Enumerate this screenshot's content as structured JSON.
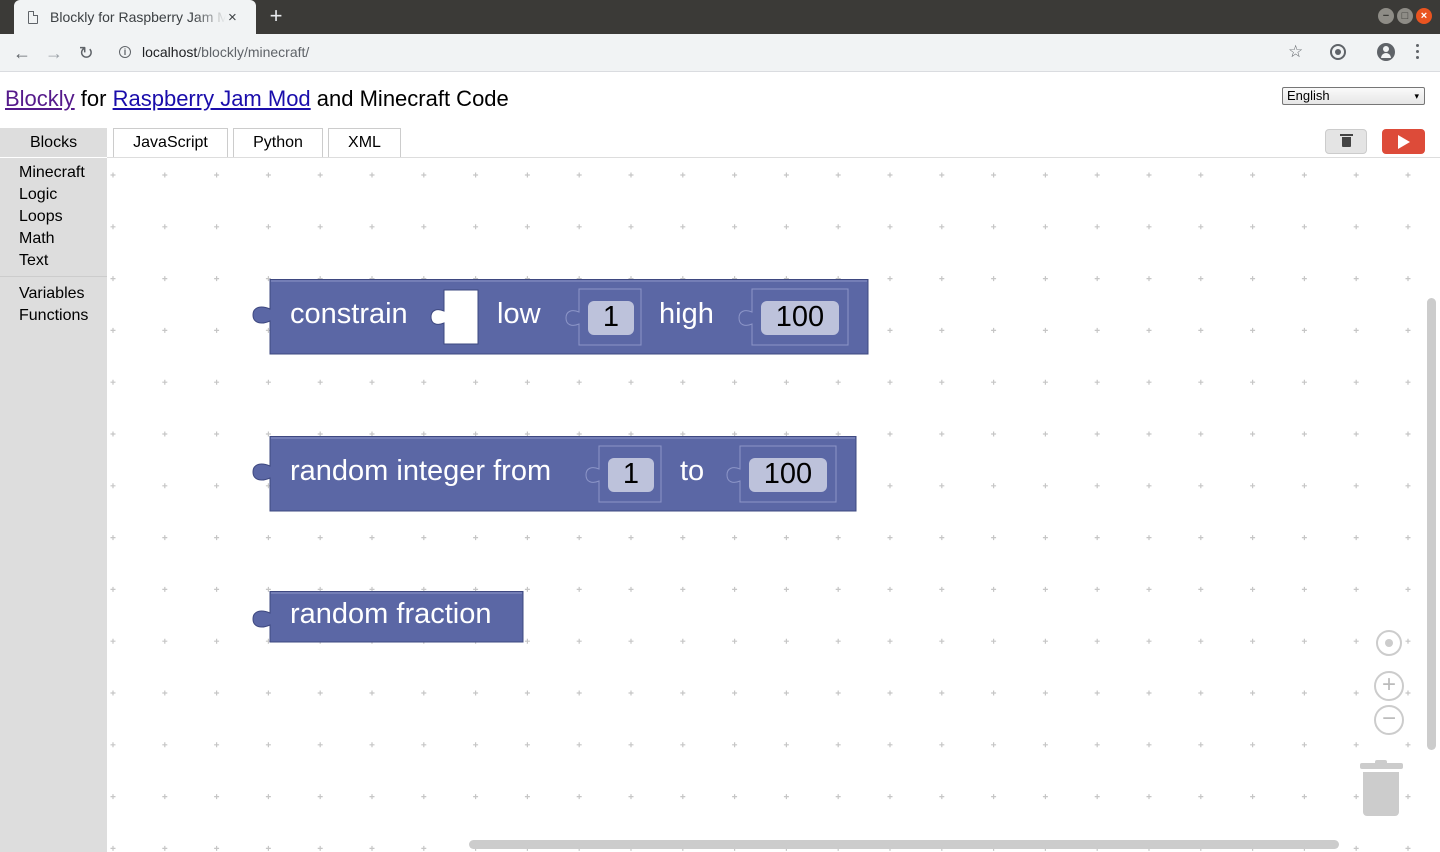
{
  "browser": {
    "tab_title": "Blockly for Raspberry Jam Mod",
    "tab_close": "×",
    "new_tab": "+",
    "url_host": "localhost",
    "url_path": "/blockly/minecraft/",
    "window_buttons": [
      "−",
      "□",
      "×"
    ]
  },
  "header": {
    "link_blockly": "Blockly",
    "text_for": " for ",
    "link_mod": "Raspberry Jam Mod",
    "text_rest": " and Minecraft Code"
  },
  "language": {
    "selected": "English",
    "arrow": "▾"
  },
  "tabs": [
    {
      "label": "Blocks",
      "selected": true
    },
    {
      "label": "JavaScript",
      "selected": false
    },
    {
      "label": "Python",
      "selected": false
    },
    {
      "label": "XML",
      "selected": false
    }
  ],
  "toolbox": {
    "categories": [
      "Minecraft",
      "Logic",
      "Loops",
      "Math",
      "Text"
    ],
    "categories2": [
      "Variables",
      "Functions"
    ]
  },
  "blocks": {
    "constrain": {
      "label": "constrain",
      "low_label": "low",
      "low_value": "1",
      "high_label": "high",
      "high_value": "100"
    },
    "random_int": {
      "label": "random integer from",
      "from_value": "1",
      "to_label": "to",
      "to_value": "100"
    },
    "random_fraction": {
      "label": "random fraction"
    }
  },
  "colors": {
    "block_fill": "#5b67a5",
    "block_stroke": "#3e4880",
    "block_light": "#8d96c8",
    "field_bg": "#bdc2db",
    "run_button": "#dd4b39",
    "toolbox_bg": "#dddddd"
  },
  "workspace_controls": {
    "zoom_in": "+",
    "zoom_out": "−"
  }
}
